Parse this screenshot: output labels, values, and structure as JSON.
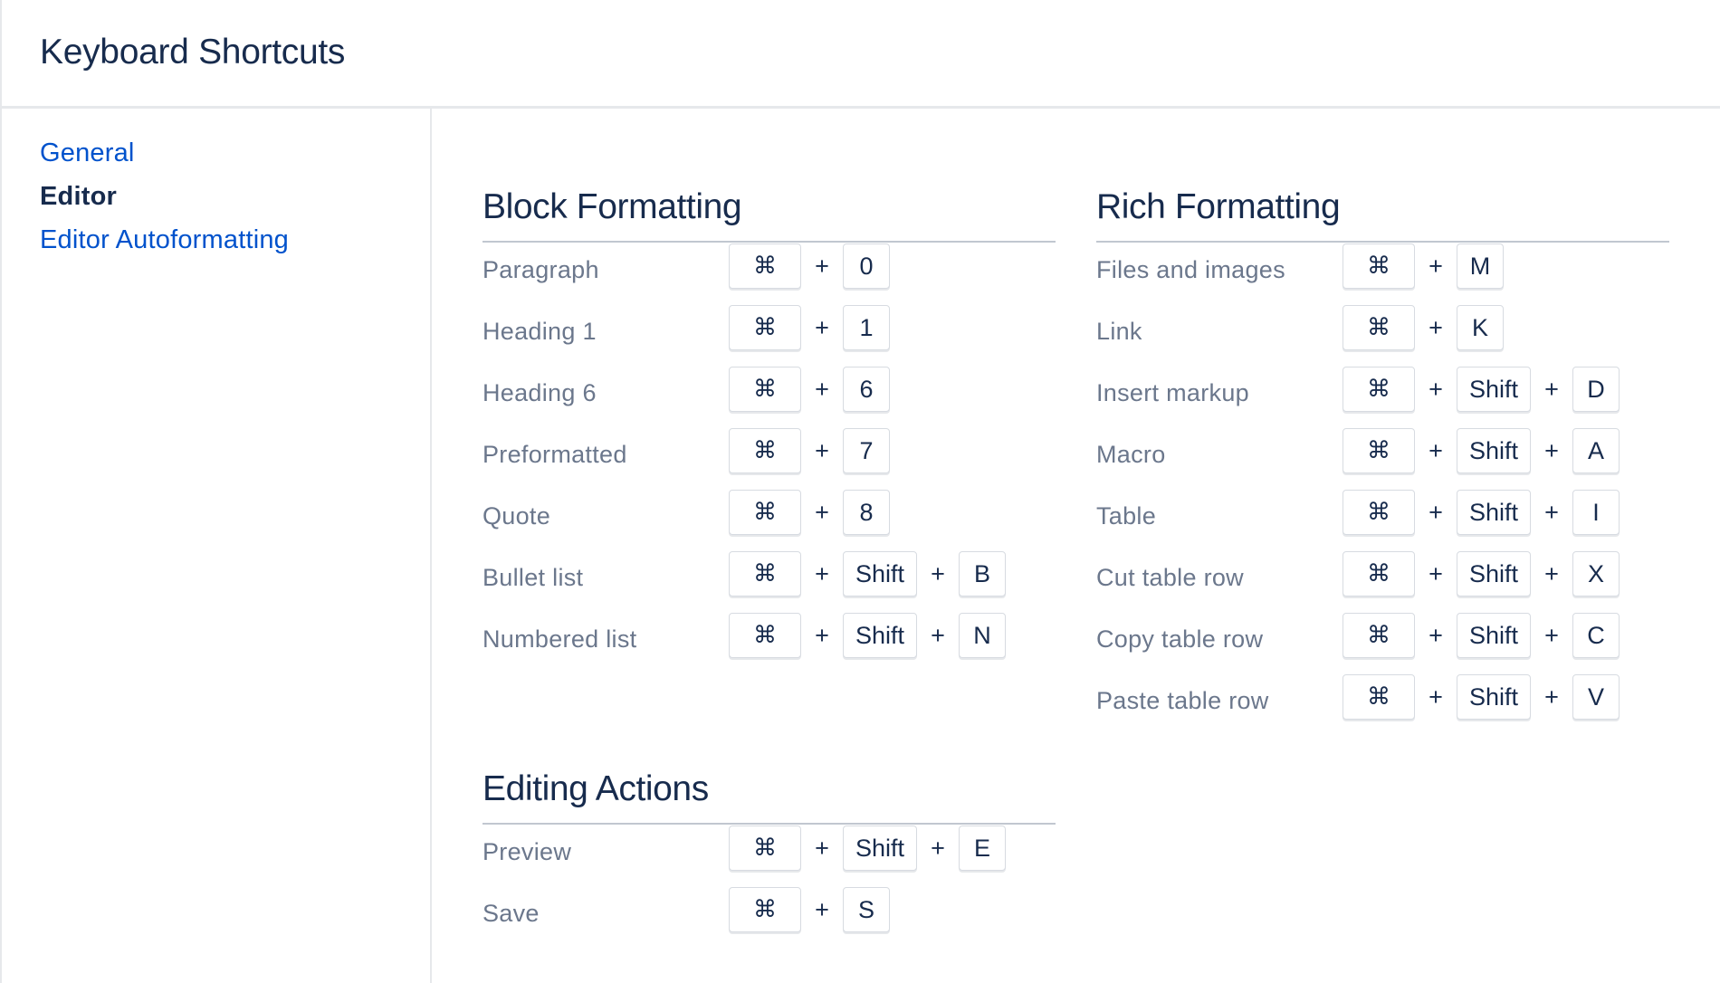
{
  "header": {
    "title": "Keyboard Shortcuts"
  },
  "sidebar": {
    "items": [
      {
        "label": "General",
        "active": false
      },
      {
        "label": "Editor",
        "active": true
      },
      {
        "label": "Editor Autoformatting",
        "active": false
      }
    ]
  },
  "keys": {
    "cmd": "⌘",
    "plus": "+"
  },
  "sections": {
    "block_formatting": {
      "title": "Block Formatting",
      "rows": [
        {
          "label": "Paragraph",
          "keys": [
            "⌘",
            "0"
          ]
        },
        {
          "label": "Heading 1",
          "keys": [
            "⌘",
            "1"
          ]
        },
        {
          "label": "Heading 6",
          "keys": [
            "⌘",
            "6"
          ]
        },
        {
          "label": "Preformatted",
          "keys": [
            "⌘",
            "7"
          ]
        },
        {
          "label": "Quote",
          "keys": [
            "⌘",
            "8"
          ]
        },
        {
          "label": "Bullet list",
          "keys": [
            "⌘",
            "Shift",
            "B"
          ]
        },
        {
          "label": "Numbered list",
          "keys": [
            "⌘",
            "Shift",
            "N"
          ]
        }
      ]
    },
    "rich_formatting": {
      "title": "Rich Formatting",
      "rows": [
        {
          "label": "Files and images",
          "keys": [
            "⌘",
            "M"
          ]
        },
        {
          "label": "Link",
          "keys": [
            "⌘",
            "K"
          ]
        },
        {
          "label": "Insert markup",
          "keys": [
            "⌘",
            "Shift",
            "D"
          ]
        },
        {
          "label": "Macro",
          "keys": [
            "⌘",
            "Shift",
            "A"
          ]
        },
        {
          "label": "Table",
          "keys": [
            "⌘",
            "Shift",
            "I"
          ]
        },
        {
          "label": "Cut table row",
          "keys": [
            "⌘",
            "Shift",
            "X"
          ]
        },
        {
          "label": "Copy table row",
          "keys": [
            "⌘",
            "Shift",
            "C"
          ]
        },
        {
          "label": "Paste table row",
          "keys": [
            "⌘",
            "Shift",
            "V"
          ]
        }
      ]
    },
    "editing_actions": {
      "title": "Editing Actions",
      "rows": [
        {
          "label": "Preview",
          "keys": [
            "⌘",
            "Shift",
            "E"
          ]
        },
        {
          "label": "Save",
          "keys": [
            "⌘",
            "S"
          ]
        }
      ]
    }
  }
}
